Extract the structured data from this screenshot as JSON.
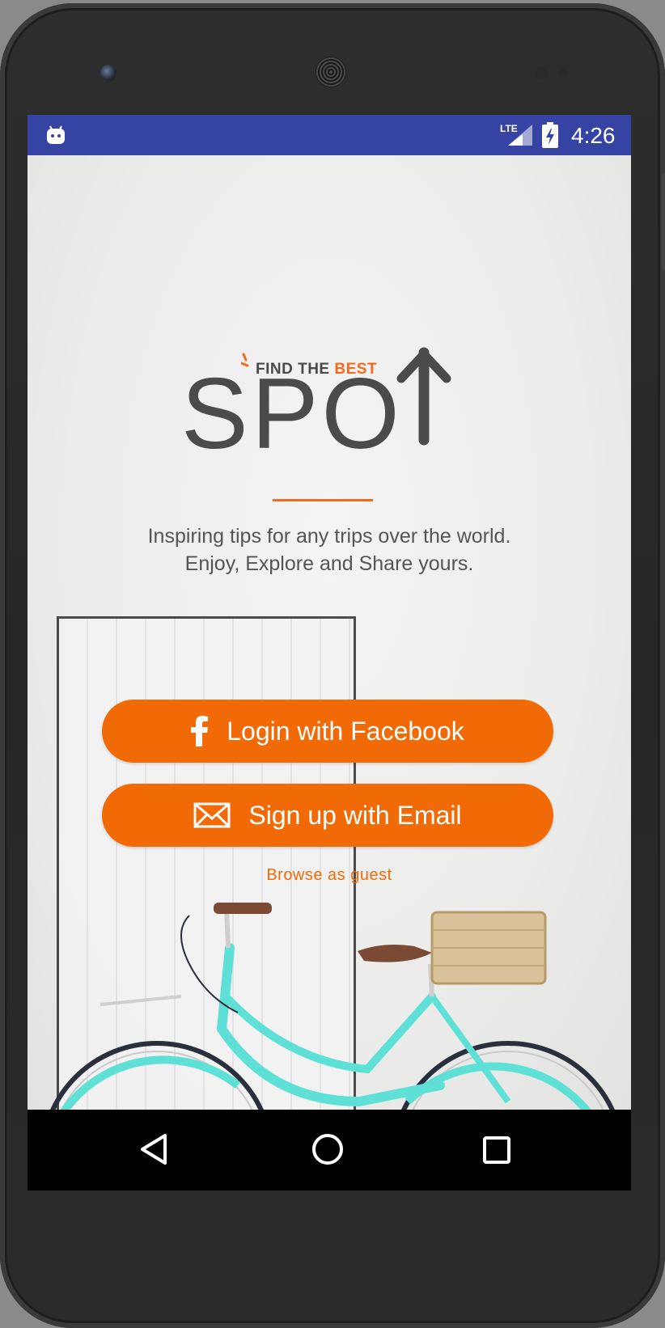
{
  "status_bar": {
    "time": "4:26",
    "network": "LTE",
    "icons": [
      "android-notification-icon",
      "lte-signal-icon",
      "battery-charging-icon"
    ],
    "background_color": "#3543a3"
  },
  "logo": {
    "tagline_prefix": "FIND THE",
    "tagline_accent": "BEST",
    "wordmark": "SPO",
    "accent_color": "#f26a1b"
  },
  "intro": {
    "line1": "Inspiring tips for any trips over the world.",
    "line2": "Enjoy, Explore and Share yours."
  },
  "actions": {
    "facebook_label": "Login with Facebook",
    "email_label": "Sign up with Email",
    "guest_label": "Browse as guest",
    "button_color": "#f26a06"
  },
  "nav_bar": {
    "icons": [
      "back-icon",
      "home-icon",
      "recents-icon"
    ]
  }
}
